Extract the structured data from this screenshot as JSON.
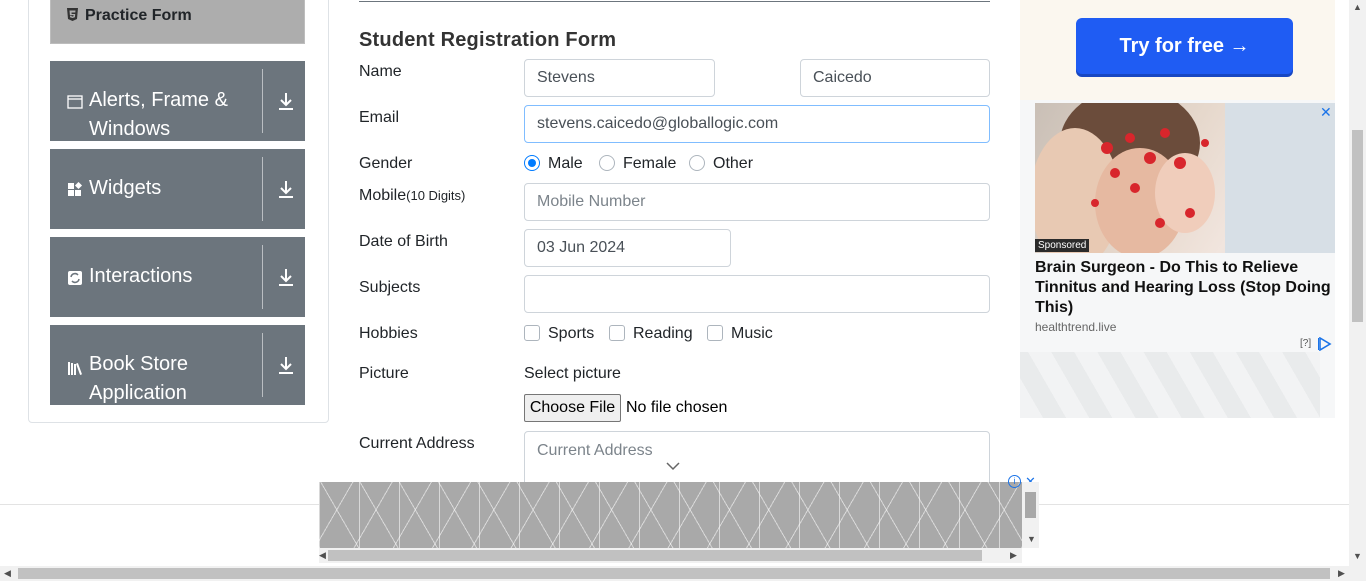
{
  "sidebar": {
    "practice_form": "Practice Form",
    "groups": [
      {
        "label_line1": "Alerts, Frame &",
        "label_line2": "Windows",
        "icon": "window-icon"
      },
      {
        "label_line1": "Widgets",
        "label_line2": "",
        "icon": "widgets-icon"
      },
      {
        "label_line1": "Interactions",
        "label_line2": "",
        "icon": "interactions-icon"
      },
      {
        "label_line1": "Book Store",
        "label_line2": "Application",
        "icon": "books-icon"
      }
    ]
  },
  "form": {
    "title": "Student Registration Form",
    "name_label": "Name",
    "first_name": "Stevens",
    "last_name": "Caicedo",
    "email_label": "Email",
    "email": "stevens.caicedo@globallogic.com",
    "gender_label": "Gender",
    "gender_options": [
      "Male",
      "Female",
      "Other"
    ],
    "gender_selected": "Male",
    "mobile_label": "Mobile",
    "mobile_hint": "(10 Digits)",
    "mobile_placeholder": "Mobile Number",
    "dob_label": "Date of Birth",
    "dob": "03 Jun 2024",
    "subjects_label": "Subjects",
    "hobbies_label": "Hobbies",
    "hobbies": [
      "Sports",
      "Reading",
      "Music"
    ],
    "picture_label": "Picture",
    "select_picture": "Select picture",
    "choose_file": "Choose File",
    "no_file": "No file chosen",
    "address_label": "Current Address",
    "address_placeholder": "Current Address"
  },
  "ad_right": {
    "cta": "Try for free →",
    "sponsored": "Sponsored",
    "headline": "Brain Surgeon - Do This to Relieve Tinnitus and Hearing Loss (Stop Doing This)",
    "domain": "healthtrend.live",
    "help": "[?]",
    "close": "✕"
  },
  "ad_bottom": {
    "close": "✕",
    "info": "i"
  },
  "colors": {
    "accent": "#007bff",
    "sidebar_group": "#6c757d",
    "practice_bg": "#adadad",
    "cta_blue": "#1f5cf3"
  }
}
